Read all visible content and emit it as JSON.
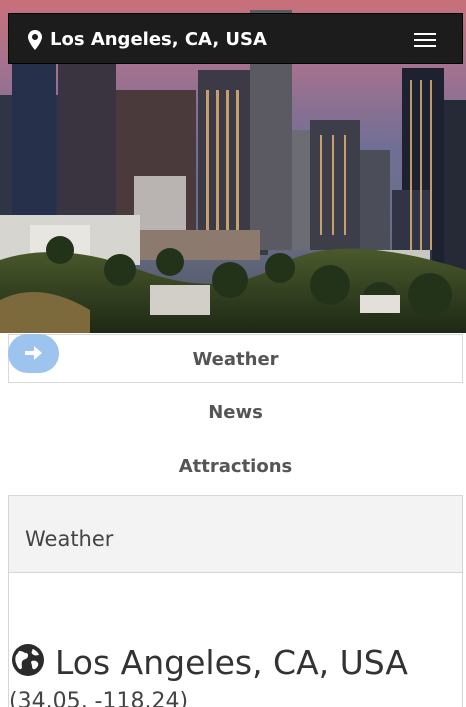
{
  "header": {
    "location": "Los Angeles, CA, USA",
    "pin_icon": "map-pin-icon",
    "menu_icon": "hamburger-menu-icon"
  },
  "nav": {
    "items": [
      {
        "label": "Weather"
      },
      {
        "label": "News"
      },
      {
        "label": "Attractions"
      }
    ],
    "arrow_icon": "arrow-right-icon"
  },
  "panel": {
    "title": "Weather",
    "globe_icon": "globe-icon",
    "city": "Los Angeles, CA, USA",
    "coords": "(34.05, -118.24)"
  }
}
